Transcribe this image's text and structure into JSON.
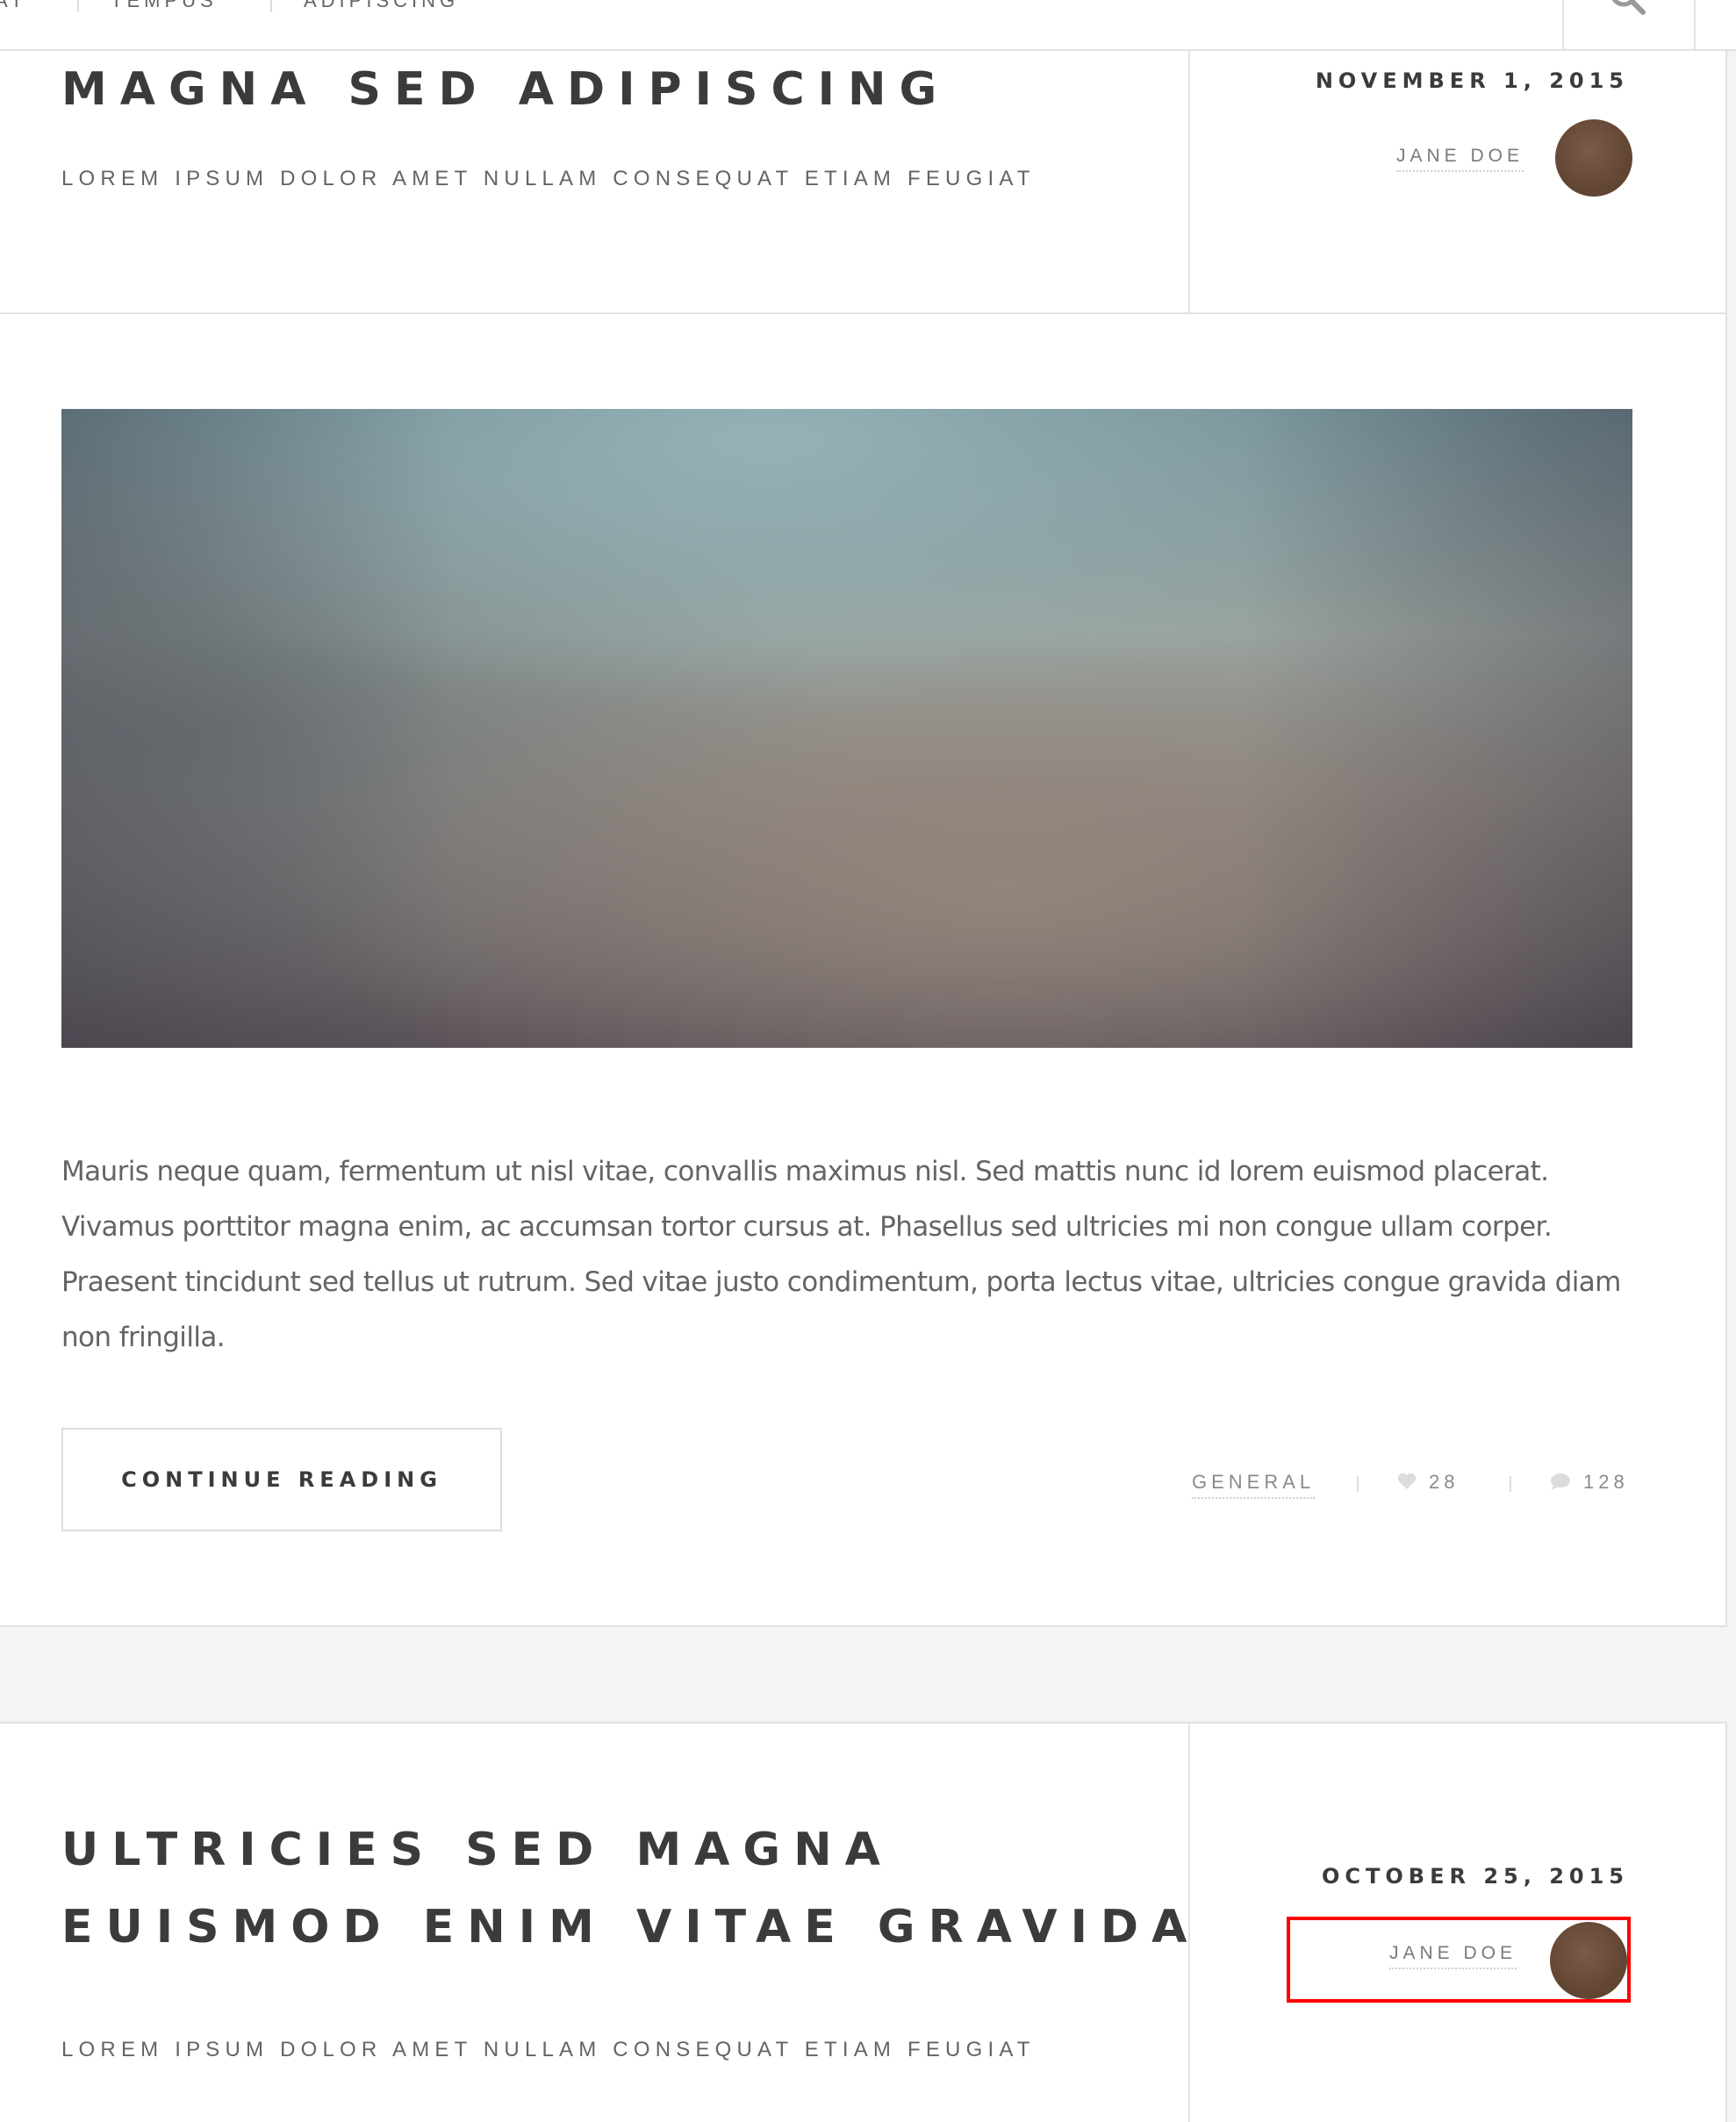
{
  "nav": {
    "items": [
      "AT",
      "TEMPUS",
      "ADIPISCING"
    ],
    "search_icon": "search-icon"
  },
  "posts": [
    {
      "title": "MAGNA SED ADIPISCING",
      "subtitle": "LOREM IPSUM DOLOR AMET NULLAM CONSEQUAT ETIAM FEUGIAT",
      "date": "NOVEMBER 1, 2015",
      "author": "JANE DOE",
      "excerpt": "Mauris neque quam, fermentum ut nisl vitae, convallis maximus nisl. Sed mattis nunc id lorem euismod placerat. Vivamus porttitor magna enim, ac accumsan tortor cursus at. Phasellus sed ultricies mi non congue ullam corper. Praesent tincidunt sed tellus ut rutrum. Sed vitae justo condimentum, porta lectus vitae, ultricies congue gravida diam non fringilla.",
      "button": "CONTINUE READING",
      "category": "GENERAL",
      "likes": "28",
      "comments": "128"
    },
    {
      "title_line1": "ULTRICIES SED MAGNA",
      "title_line2": "EUISMOD ENIM VITAE GRAVIDA",
      "subtitle": "LOREM IPSUM DOLOR AMET NULLAM CONSEQUAT ETIAM FEUGIAT",
      "date": "OCTOBER 25, 2015",
      "author": "JANE DOE"
    }
  ],
  "colors": {
    "heading": "#3c3b3b",
    "muted": "#646464",
    "border": "#e2e2e2",
    "avatar": "#634734",
    "highlight": "#ff0000"
  }
}
